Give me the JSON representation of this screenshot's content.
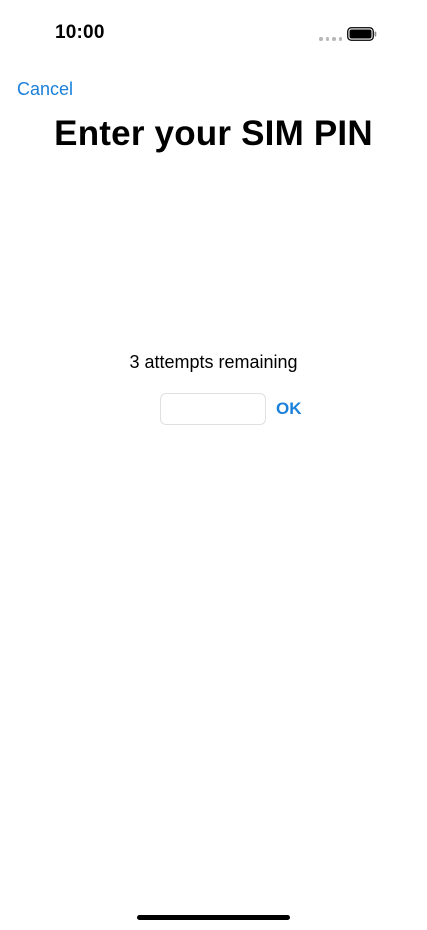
{
  "status_bar": {
    "time": "10:00",
    "signal_icon": "signal-dots-icon",
    "battery_icon": "battery-icon",
    "battery_level": 1.0
  },
  "nav": {
    "cancel_label": "Cancel"
  },
  "page": {
    "title": "Enter your SIM PIN"
  },
  "pin": {
    "attempts_text": "3 attempts remaining",
    "input_value": "",
    "ok_label": "OK"
  },
  "colors": {
    "accent": "#1a80d9",
    "text": "#000000",
    "background": "#ffffff"
  }
}
